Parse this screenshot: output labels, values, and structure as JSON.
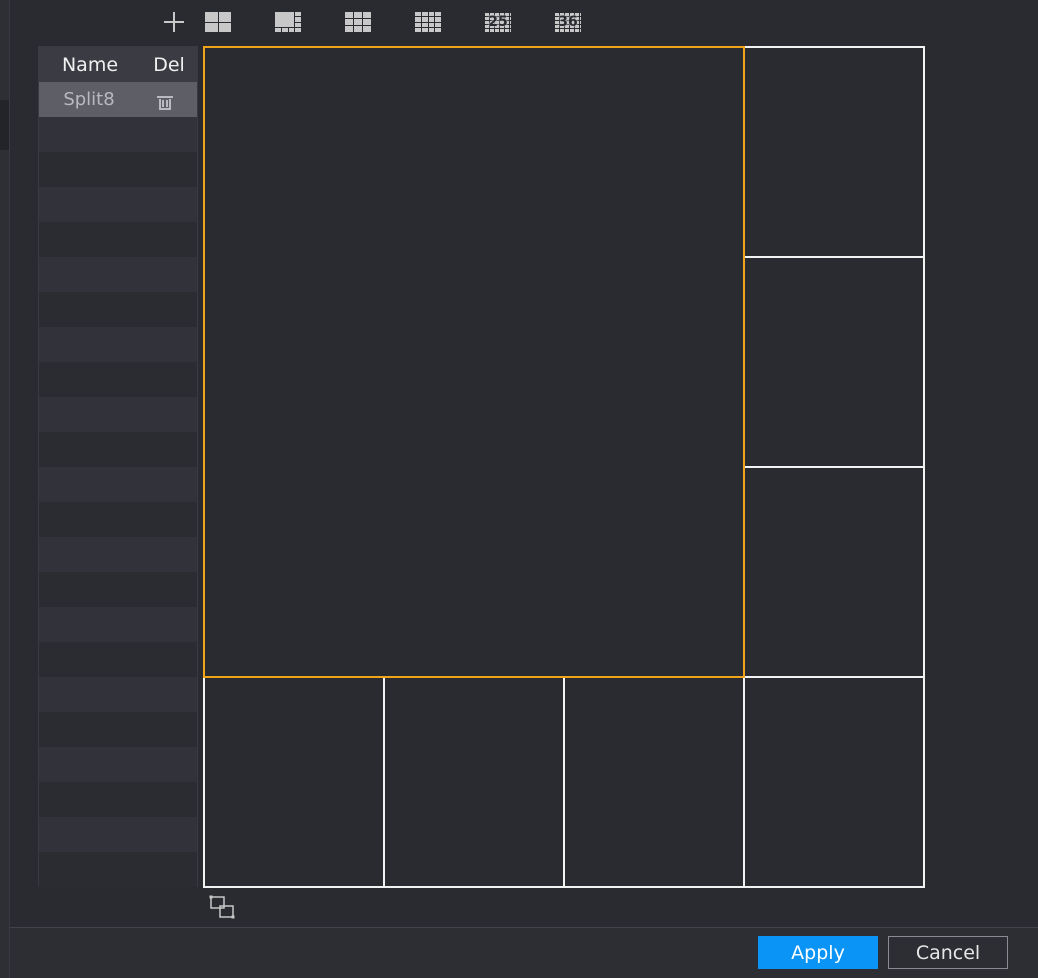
{
  "toolbar": {
    "icons": [
      "add-icon",
      "split-4-icon",
      "split-8-icon",
      "split-9-icon",
      "split-16-icon",
      "split-25-icon",
      "split-36-icon"
    ],
    "split25_label": "25",
    "split36_label": "36"
  },
  "scheme_list": {
    "header": {
      "name": "Name",
      "del": "Del"
    },
    "rows": [
      {
        "name": "Split8",
        "selected": true
      }
    ]
  },
  "split_canvas": {
    "layout": "split-8",
    "active_pane": 1,
    "colors": {
      "active": "#f0a41c",
      "border": "#f2f2f2"
    }
  },
  "footer": {
    "apply_label": "Apply",
    "cancel_label": "Cancel"
  },
  "colors": {
    "background": "#2a2b31",
    "accent": "#0a94f5",
    "selected_row": "#5d5e66"
  }
}
